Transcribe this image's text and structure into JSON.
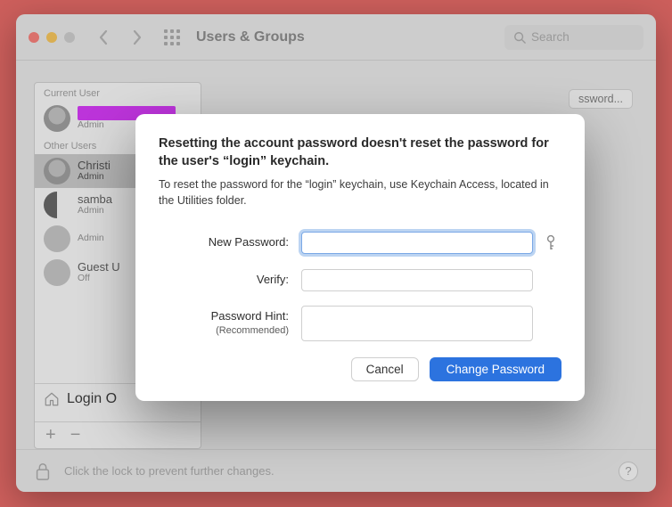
{
  "window": {
    "title": "Users & Groups",
    "search_placeholder": "Search",
    "change_password_btn": "ssword...",
    "footer_hint": "Click the lock to prevent further changes."
  },
  "sidebar": {
    "section_current": "Current User",
    "section_other": "Other Users",
    "login_options_label": "Login O",
    "users": [
      {
        "name_redacted": true,
        "name": "",
        "role": "Admin",
        "selected": false
      },
      {
        "name": "Christi",
        "role": "Admin",
        "selected": true
      },
      {
        "name": "samba",
        "role": "Admin",
        "selected": false
      },
      {
        "name": "",
        "role": "Admin",
        "selected": false
      },
      {
        "name": "Guest U",
        "role": "Off",
        "selected": false
      }
    ]
  },
  "modal": {
    "title": "Resetting the account password doesn't reset the password for the user's “login” keychain.",
    "subtitle": "To reset the password for the “login” keychain, use Keychain Access, located in the Utilities folder.",
    "labels": {
      "new_pw": "New Password:",
      "verify": "Verify:",
      "hint": "Password Hint:",
      "hint_rec": "(Recommended)"
    },
    "buttons": {
      "cancel": "Cancel",
      "change": "Change Password"
    }
  }
}
